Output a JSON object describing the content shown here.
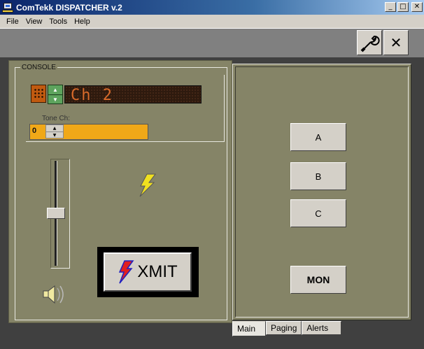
{
  "window": {
    "title": "ComTekk DISPATCHER v.2",
    "controls": [
      "minimize",
      "maximize",
      "close"
    ]
  },
  "menu": {
    "items": [
      {
        "label": "File"
      },
      {
        "label": "View"
      },
      {
        "label": "Tools"
      },
      {
        "label": "Help"
      }
    ]
  },
  "toolbar": {
    "settings_icon": "wrench-icon",
    "close_icon": "close-icon",
    "close_glyph": "✕"
  },
  "console": {
    "title": "CONSOLE",
    "channel_display": "Ch 2",
    "tone": {
      "label": "Tone Ch:",
      "value": "0"
    },
    "volume_level": 0.5,
    "xmit_label": "XMIT"
  },
  "right_panel": {
    "buttons": [
      {
        "label": "A"
      },
      {
        "label": "B"
      },
      {
        "label": "C"
      }
    ],
    "monitor_label": "MON"
  },
  "tabs": [
    {
      "label": "Main",
      "active": true
    },
    {
      "label": "Paging",
      "active": false
    },
    {
      "label": "Alerts",
      "active": false
    }
  ],
  "colors": {
    "panel": "#858467",
    "led_text": "#d86a2a",
    "tone_field": "#f0a818",
    "bolt": "#f0e020"
  }
}
